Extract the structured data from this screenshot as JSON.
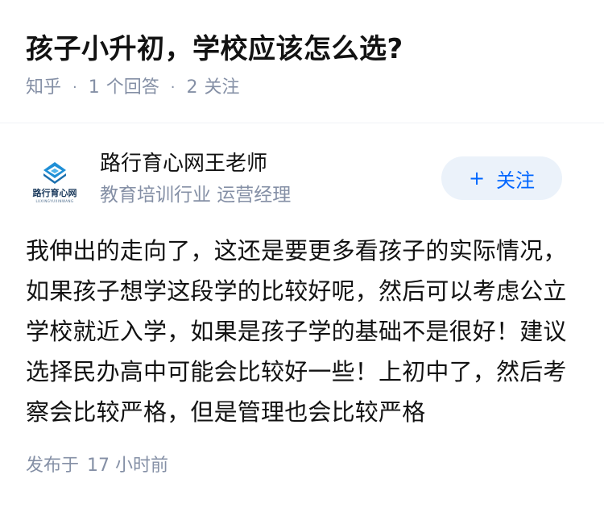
{
  "question": {
    "title": "孩子小升初，学校应该怎么选?",
    "source": "知乎",
    "answer_count": "1",
    "answer_label": "个回答",
    "follow_count": "2",
    "follow_label": "关注"
  },
  "answer": {
    "author_name": "路行育心网王老师",
    "author_headline": "教育培训行业 运营经理",
    "avatar_logo_text": "路行育心网",
    "avatar_logo_sub": "LUXINGYUXINWANG",
    "follow_button": "关注",
    "content": "我伸出的走向了，这还是要更多看孩子的实际情况，如果孩子想学这段学的比较好呢，然后可以考虑公立学校就近入学，如果是孩子学的基础不是很好！建议选择民办高中可能会比较好一些！上初中了，然后考察会比较严格，但是管理也会比较严格",
    "publish_label": "发布于",
    "publish_time": "17 小时前"
  },
  "colors": {
    "accent": "#0066ff",
    "follow_bg": "#ebf2fa",
    "meta_gray": "#8590a6",
    "logo_blue": "#1f8fd6"
  },
  "icons": {
    "avatar": "logo-icon",
    "follow": "plus-icon"
  }
}
